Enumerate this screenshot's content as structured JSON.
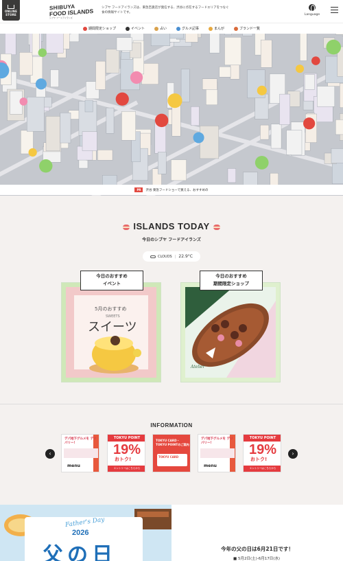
{
  "header": {
    "store_badge": [
      "ONLINE",
      "STORE"
    ],
    "logo_line1": "SHIBUYA",
    "logo_line2": "FOOD ISLANDS",
    "logo_sub": "シブヤ フードアイランズ",
    "tagline": "シブヤ フードアイランズは、東急百貨店が発信する、渋谷に点在するフードエリアをつなぐ食の情報サイトです。",
    "language_label": "Language"
  },
  "nav": {
    "items": [
      {
        "label": "期間限定ショップ",
        "color": "#e2483f"
      },
      {
        "label": "イベント",
        "color": "#333333"
      },
      {
        "label": "占い",
        "color": "#d9a14b"
      },
      {
        "label": "グルメ記事",
        "color": "#4a8fd1"
      },
      {
        "label": "まんが",
        "color": "#e7a940"
      },
      {
        "label": "ブランド一覧",
        "color": "#d96b3b"
      }
    ]
  },
  "hero": {
    "caption_tag": "PR",
    "caption": "渋谷 東急フードショーで買える、おすすめの"
  },
  "today": {
    "title": "ISLANDS TODAY",
    "subtitle": "今日のシブヤ フードアイランズ",
    "weather_label": "CLOUDS",
    "temperature": "22.9°C",
    "cards": [
      {
        "label": "今日のおすすめ",
        "kind": "イベント",
        "img_top": "5月のおすすめ",
        "img_en": "SWEETS",
        "img_big": "スイーツ"
      },
      {
        "label": "今日のおすすめ",
        "kind": "期間限定ショップ",
        "img_note": "Atelier"
      }
    ]
  },
  "info": {
    "title": "INFORMATION",
    "prev_icon": "chevron-left-icon",
    "next_icon": "chevron-right-icon",
    "banners": [
      {
        "type": "depa",
        "head": "デパ地下グルメを デリバリー!",
        "brand": "menu"
      },
      {
        "type": "tokyu",
        "head": "TOKYU POINT",
        "big": "19%",
        "otoku": "おトク!",
        "foot": "エントリーはこちらから"
      },
      {
        "type": "card",
        "head": "TOKYU CARD・TOKYU POINTのご案内",
        "card": "TOKYU CARD"
      },
      {
        "type": "depa",
        "head": "デパ地下グルメを デリバリー!",
        "brand": "menu"
      },
      {
        "type": "tokyu",
        "head": "TOKYU POINT",
        "big": "19%",
        "otoku": "おトク!",
        "foot": "エントリーはこちらから"
      }
    ]
  },
  "promo": {
    "script": "Father's Day",
    "year": "2026",
    "big": "父の日",
    "title": "今年の父の日は6月21日です！",
    "date": "■ 5月2日(土)-6月17日(水)"
  }
}
